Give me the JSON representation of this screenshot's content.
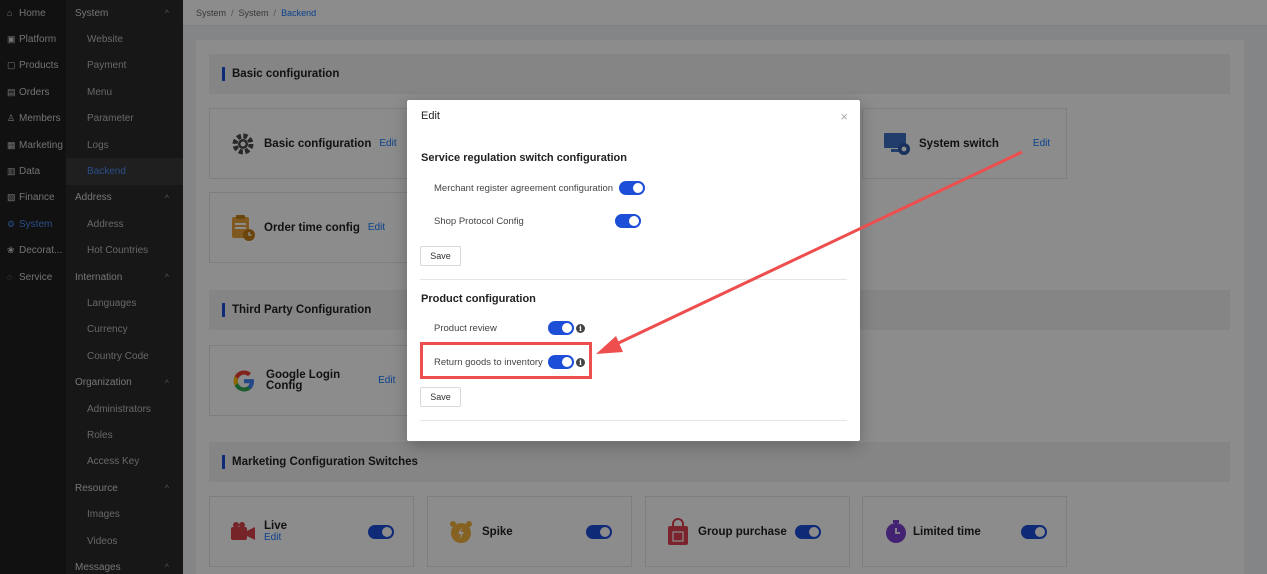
{
  "nav_primary": [
    {
      "icon": "home-icon",
      "glyph": "⌂",
      "label": "Home"
    },
    {
      "icon": "platform-icon",
      "glyph": "▣",
      "label": "Platform"
    },
    {
      "icon": "products-icon",
      "glyph": "▢",
      "label": "Products"
    },
    {
      "icon": "orders-icon",
      "glyph": "▤",
      "label": "Orders"
    },
    {
      "icon": "members-icon",
      "glyph": "♙",
      "label": "Members"
    },
    {
      "icon": "marketing-icon",
      "glyph": "▦",
      "label": "Marketing"
    },
    {
      "icon": "data-icon",
      "glyph": "▥",
      "label": "Data"
    },
    {
      "icon": "finance-icon",
      "glyph": "▧",
      "label": "Finance"
    },
    {
      "icon": "system-icon",
      "glyph": "⚙",
      "label": "System"
    },
    {
      "icon": "decoration-icon",
      "glyph": "❀",
      "label": "Decorat..."
    },
    {
      "icon": "service-icon",
      "glyph": "◌",
      "label": "Service"
    }
  ],
  "nav_secondary": [
    {
      "type": "group",
      "label": "System"
    },
    {
      "type": "item",
      "label": "Website"
    },
    {
      "type": "item",
      "label": "Payment"
    },
    {
      "type": "item",
      "label": "Menu"
    },
    {
      "type": "item",
      "label": "Parameter"
    },
    {
      "type": "item",
      "label": "Logs"
    },
    {
      "type": "item",
      "label": "Backend",
      "active": true
    },
    {
      "type": "group",
      "label": "Address"
    },
    {
      "type": "item",
      "label": "Address"
    },
    {
      "type": "item",
      "label": "Hot Countries"
    },
    {
      "type": "group",
      "label": "Internation"
    },
    {
      "type": "item",
      "label": "Languages"
    },
    {
      "type": "item",
      "label": "Currency"
    },
    {
      "type": "item",
      "label": "Country Code"
    },
    {
      "type": "group",
      "label": "Organization"
    },
    {
      "type": "item",
      "label": "Administrators"
    },
    {
      "type": "item",
      "label": "Roles"
    },
    {
      "type": "item",
      "label": "Access Key"
    },
    {
      "type": "group",
      "label": "Resource"
    },
    {
      "type": "item",
      "label": "Images"
    },
    {
      "type": "item",
      "label": "Videos"
    },
    {
      "type": "group",
      "label": "Messages"
    }
  ],
  "breadcrumb": {
    "l1": "System",
    "l2": "System",
    "l3": "Backend",
    "sep": "/"
  },
  "sections": {
    "basic": "Basic configuration",
    "third": "Third Party Configuration",
    "marketing": "Marketing Configuration Switches"
  },
  "cards": {
    "basic_config": {
      "title": "Basic configuration",
      "edit": "Edit"
    },
    "system_switch": {
      "title": "System switch",
      "edit": "Edit"
    },
    "order_time": {
      "title": "Order time config",
      "edit": "Edit"
    },
    "google": {
      "title_line1": "Google Login",
      "title_line2": "Config",
      "edit": "Edit"
    },
    "live": {
      "title": "Live",
      "edit": "Edit"
    },
    "spike": {
      "title": "Spike"
    },
    "group": {
      "title": "Group purchase"
    },
    "limited": {
      "title": "Limited time"
    }
  },
  "modal": {
    "title": "Edit",
    "close": "×",
    "service": {
      "title": "Service regulation switch configuration",
      "row1": "Merchant register agreement configuration",
      "row2": "Shop Protocol Config",
      "save": "Save"
    },
    "product": {
      "title": "Product configuration",
      "row1": "Product review",
      "row2": "Return goods to inventory",
      "save": "Save"
    },
    "info_glyph": "i"
  },
  "colors": {
    "accent": "#1d4ed8",
    "link": "#1677ff",
    "highlight": "#ee4e4e"
  }
}
